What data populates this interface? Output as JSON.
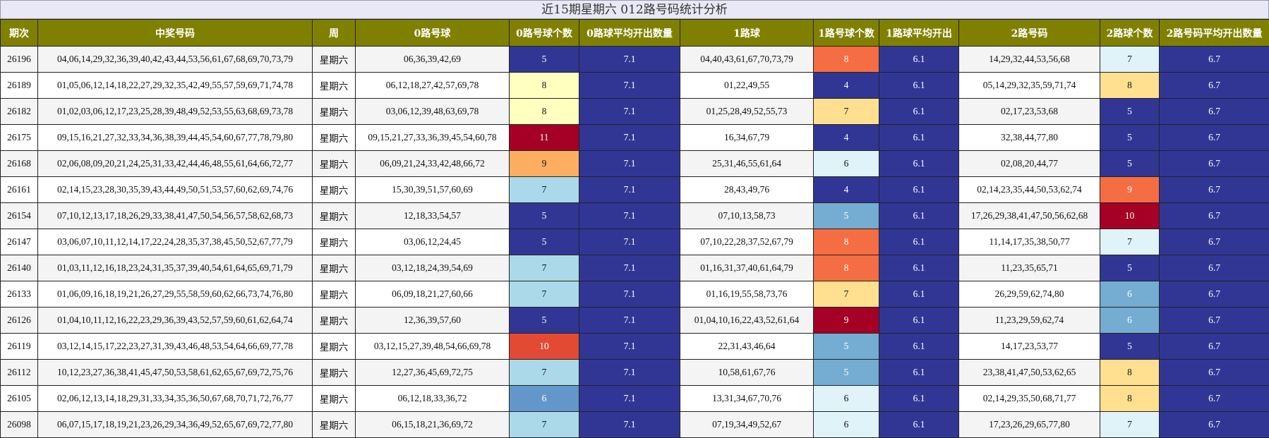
{
  "title": "近15期星期六 012路号码统计分析",
  "headers": [
    "期次",
    "中奖号码",
    "周",
    "0路号球",
    "0路号球个数",
    "0路球平均开出数量",
    "1路球",
    "1路号球个数",
    "1路球平均开出",
    "2路号码",
    "2路球个数",
    "2路号码平均开出数量"
  ],
  "rows": [
    [
      "26196",
      "04,06,14,29,32,36,39,40,42,43,44,53,56,61,67,68,69,70,73,79",
      "星期六",
      "06,36,39,42,69",
      "5",
      "7.1",
      "04,40,43,61,67,70,73,79",
      "8",
      "6.1",
      "14,29,32,44,53,56,68",
      "7",
      "6.7"
    ],
    [
      "26189",
      "01,05,06,12,14,18,22,27,29,32,35,42,49,55,57,59,69,71,74,78",
      "星期六",
      "06,12,18,27,42,57,69,78",
      "8",
      "7.1",
      "01,22,49,55",
      "4",
      "6.1",
      "05,14,29,32,35,59,71,74",
      "8",
      "6.7"
    ],
    [
      "26182",
      "01,02,03,06,12,17,23,25,28,39,48,49,52,53,55,63,68,69,73,78",
      "星期六",
      "03,06,12,39,48,63,69,78",
      "8",
      "7.1",
      "01,25,28,49,52,55,73",
      "7",
      "6.1",
      "02,17,23,53,68",
      "5",
      "6.7"
    ],
    [
      "26175",
      "09,15,16,21,27,32,33,34,36,38,39,44,45,54,60,67,77,78,79,80",
      "星期六",
      "09,15,21,27,33,36,39,45,54,60,78",
      "11",
      "7.1",
      "16,34,67,79",
      "4",
      "6.1",
      "32,38,44,77,80",
      "5",
      "6.7"
    ],
    [
      "26168",
      "02,06,08,09,20,21,24,25,31,33,42,44,46,48,55,61,64,66,72,77",
      "星期六",
      "06,09,21,24,33,42,48,66,72",
      "9",
      "7.1",
      "25,31,46,55,61,64",
      "6",
      "6.1",
      "02,08,20,44,77",
      "5",
      "6.7"
    ],
    [
      "26161",
      "02,14,15,23,28,30,35,39,43,44,49,50,51,53,57,60,62,69,74,76",
      "星期六",
      "15,30,39,51,57,60,69",
      "7",
      "7.1",
      "28,43,49,76",
      "4",
      "6.1",
      "02,14,23,35,44,50,53,62,74",
      "9",
      "6.7"
    ],
    [
      "26154",
      "07,10,12,13,17,18,26,29,33,38,41,47,50,54,56,57,58,62,68,73",
      "星期六",
      "12,18,33,54,57",
      "5",
      "7.1",
      "07,10,13,58,73",
      "5",
      "6.1",
      "17,26,29,38,41,47,50,56,62,68",
      "10",
      "6.7"
    ],
    [
      "26147",
      "03,06,07,10,11,12,14,17,22,24,28,35,37,38,45,50,52,67,77,79",
      "星期六",
      "03,06,12,24,45",
      "5",
      "7.1",
      "07,10,22,28,37,52,67,79",
      "8",
      "6.1",
      "11,14,17,35,38,50,77",
      "7",
      "6.7"
    ],
    [
      "26140",
      "01,03,11,12,16,18,23,24,31,35,37,39,40,54,61,64,65,69,71,79",
      "星期六",
      "03,12,18,24,39,54,69",
      "7",
      "7.1",
      "01,16,31,37,40,61,64,79",
      "8",
      "6.1",
      "11,23,35,65,71",
      "5",
      "6.7"
    ],
    [
      "26133",
      "01,06,09,16,18,19,21,26,27,29,55,58,59,60,62,66,73,74,76,80",
      "星期六",
      "06,09,18,21,27,60,66",
      "7",
      "7.1",
      "01,16,19,55,58,73,76",
      "7",
      "6.1",
      "26,29,59,62,74,80",
      "6",
      "6.7"
    ],
    [
      "26126",
      "01,04,10,11,12,16,22,23,29,36,39,43,52,57,59,60,61,62,64,74",
      "星期六",
      "12,36,39,57,60",
      "5",
      "7.1",
      "01,04,10,16,22,43,52,61,64",
      "9",
      "6.1",
      "11,23,29,59,62,74",
      "6",
      "6.7"
    ],
    [
      "26119",
      "03,12,14,15,17,22,23,27,31,39,43,46,48,53,54,64,66,69,77,78",
      "星期六",
      "03,12,15,27,39,48,54,66,69,78",
      "10",
      "7.1",
      "22,31,43,46,64",
      "5",
      "6.1",
      "14,17,23,53,77",
      "5",
      "6.7"
    ],
    [
      "26112",
      "10,12,23,27,36,38,41,45,47,50,53,58,61,62,65,67,69,72,75,76",
      "星期六",
      "12,27,36,45,69,72,75",
      "7",
      "7.1",
      "10,58,61,67,76",
      "5",
      "6.1",
      "23,38,41,47,50,53,62,65",
      "8",
      "6.7"
    ],
    [
      "26105",
      "02,06,12,13,14,18,29,31,33,34,35,36,50,67,68,70,71,72,76,77",
      "星期六",
      "06,12,18,33,36,72",
      "6",
      "7.1",
      "13,31,34,67,70,76",
      "6",
      "6.1",
      "02,14,29,35,50,68,71,77",
      "8",
      "6.7"
    ],
    [
      "26098",
      "06,07,15,17,18,19,21,23,26,29,34,36,49,52,65,67,69,72,77,80",
      "星期六",
      "06,15,18,21,36,69,72",
      "7",
      "7.1",
      "07,19,34,49,52,67",
      "6",
      "6.1",
      "17,23,26,29,65,77,80",
      "7",
      "6.7"
    ]
  ],
  "count_color_scale": {
    "4": {
      "bg": "#313695",
      "fg": "#ffffff"
    },
    "5": {
      "bg": "#313695",
      "fg": "#ffffff"
    },
    "6": {
      "bg": "#e0f3f8",
      "fg": "#111111"
    },
    "7": {
      "bg": "#abd9e9",
      "fg": "#111111"
    },
    "8": {
      "bg": "#fee090",
      "fg": "#111111"
    },
    "9": {
      "bg": "#fdae61",
      "fg": "#111111"
    },
    "10": {
      "bg": "#f46d43",
      "fg": "#ffffff"
    },
    "11": {
      "bg": "#a50026",
      "fg": "#ffffff"
    }
  },
  "cell_colors": {
    "count0": [
      {
        "bg": "#313695",
        "fg": "#ffffff"
      },
      {
        "bg": "#ffffbf",
        "fg": "#111111"
      },
      {
        "bg": "#ffffbf",
        "fg": "#111111"
      },
      {
        "bg": "#a50026",
        "fg": "#ffffff"
      },
      {
        "bg": "#fdae61",
        "fg": "#111111"
      },
      {
        "bg": "#abd9e9",
        "fg": "#111111"
      },
      {
        "bg": "#313695",
        "fg": "#ffffff"
      },
      {
        "bg": "#313695",
        "fg": "#ffffff"
      },
      {
        "bg": "#abd9e9",
        "fg": "#111111"
      },
      {
        "bg": "#abd9e9",
        "fg": "#111111"
      },
      {
        "bg": "#313695",
        "fg": "#ffffff"
      },
      {
        "bg": "#e34a33",
        "fg": "#ffffff"
      },
      {
        "bg": "#abd9e9",
        "fg": "#111111"
      },
      {
        "bg": "#6497c9",
        "fg": "#ffffff"
      },
      {
        "bg": "#abd9e9",
        "fg": "#111111"
      }
    ],
    "count1": [
      {
        "bg": "#f46d43",
        "fg": "#ffffff"
      },
      {
        "bg": "#313695",
        "fg": "#ffffff"
      },
      {
        "bg": "#fee090",
        "fg": "#111111"
      },
      {
        "bg": "#313695",
        "fg": "#ffffff"
      },
      {
        "bg": "#e0f3f8",
        "fg": "#111111"
      },
      {
        "bg": "#313695",
        "fg": "#ffffff"
      },
      {
        "bg": "#74add1",
        "fg": "#ffffff"
      },
      {
        "bg": "#f46d43",
        "fg": "#ffffff"
      },
      {
        "bg": "#f46d43",
        "fg": "#ffffff"
      },
      {
        "bg": "#fee090",
        "fg": "#111111"
      },
      {
        "bg": "#a50026",
        "fg": "#ffffff"
      },
      {
        "bg": "#74add1",
        "fg": "#ffffff"
      },
      {
        "bg": "#74add1",
        "fg": "#ffffff"
      },
      {
        "bg": "#e0f3f8",
        "fg": "#111111"
      },
      {
        "bg": "#e0f3f8",
        "fg": "#111111"
      }
    ],
    "count2": [
      {
        "bg": "#e0f3f8",
        "fg": "#111111"
      },
      {
        "bg": "#fee090",
        "fg": "#111111"
      },
      {
        "bg": "#313695",
        "fg": "#ffffff"
      },
      {
        "bg": "#313695",
        "fg": "#ffffff"
      },
      {
        "bg": "#313695",
        "fg": "#ffffff"
      },
      {
        "bg": "#f46d43",
        "fg": "#ffffff"
      },
      {
        "bg": "#a50026",
        "fg": "#ffffff"
      },
      {
        "bg": "#e0f3f8",
        "fg": "#111111"
      },
      {
        "bg": "#313695",
        "fg": "#ffffff"
      },
      {
        "bg": "#74add1",
        "fg": "#ffffff"
      },
      {
        "bg": "#74add1",
        "fg": "#ffffff"
      },
      {
        "bg": "#313695",
        "fg": "#ffffff"
      },
      {
        "bg": "#fee090",
        "fg": "#111111"
      },
      {
        "bg": "#fee090",
        "fg": "#111111"
      },
      {
        "bg": "#e0f3f8",
        "fg": "#111111"
      }
    ]
  },
  "header_bg": "#808000",
  "avg_bg": "#313695"
}
